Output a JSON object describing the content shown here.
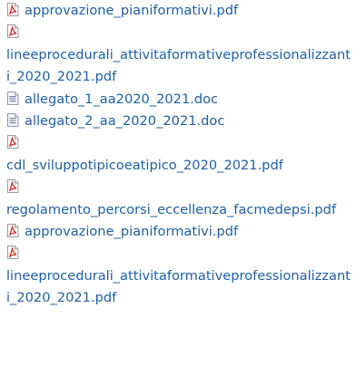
{
  "colors": {
    "link": "#1f5fa3",
    "pdf_icon": "#d42a1f",
    "doc_icon": "#6f87a6"
  },
  "files": [
    {
      "name": "approvazione_pianiformativi.pdf",
      "icon": "pdf-icon"
    },
    {
      "name": "lineeprocedurali_attivitaformativeprofessionalizzanti_2020_2021.pdf",
      "icon": "pdf-icon"
    },
    {
      "name": "allegato_1_aa2020_2021.doc",
      "icon": "doc-icon"
    },
    {
      "name": "allegato_2_aa_2020_2021.doc",
      "icon": "doc-icon"
    },
    {
      "name": "cdl_sviluppotipicoeatipico_2020_2021.pdf",
      "icon": "pdf-icon"
    },
    {
      "name": "regolamento_percorsi_eccellenza_facmedepsi.pdf",
      "icon": "pdf-icon"
    },
    {
      "name": "approvazione_pianiformativi.pdf",
      "icon": "pdf-icon"
    },
    {
      "name": "lineeprocedurali_attivitaformativeprofessionalizzanti_2020_2021.pdf",
      "icon": "pdf-icon"
    }
  ]
}
